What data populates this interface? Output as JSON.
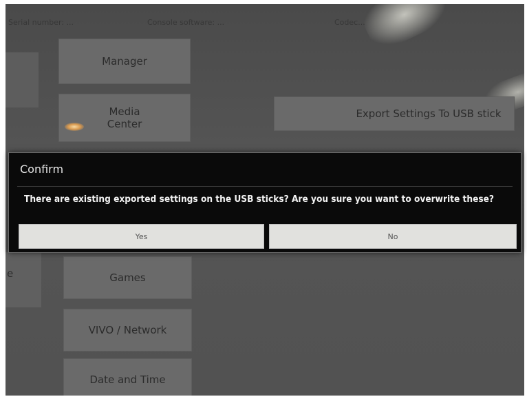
{
  "status_bar": {
    "left_text": "Serial number: ...",
    "middle_text": "Console software: ...",
    "right_text": "Codec..."
  },
  "menu": {
    "manager": "Manager",
    "media_center": "Media\nCenter",
    "games": "Games",
    "vivo_network": "VIVO / Network",
    "date_and_time": "Date and Time",
    "export_settings": "Export Settings To USB stick",
    "left_fragment": "e"
  },
  "dialog": {
    "title": "Confirm",
    "message": "There are existing exported settings on the USB sticks? Are you sure you want to overwrite these?",
    "yes_label": "Yes",
    "no_label": "No"
  },
  "colors": {
    "dialog_background": "#0a0a0a",
    "dialog_button": "#e1e1de",
    "screen_background": "#525252",
    "menu_button": "#6a6a6a"
  }
}
